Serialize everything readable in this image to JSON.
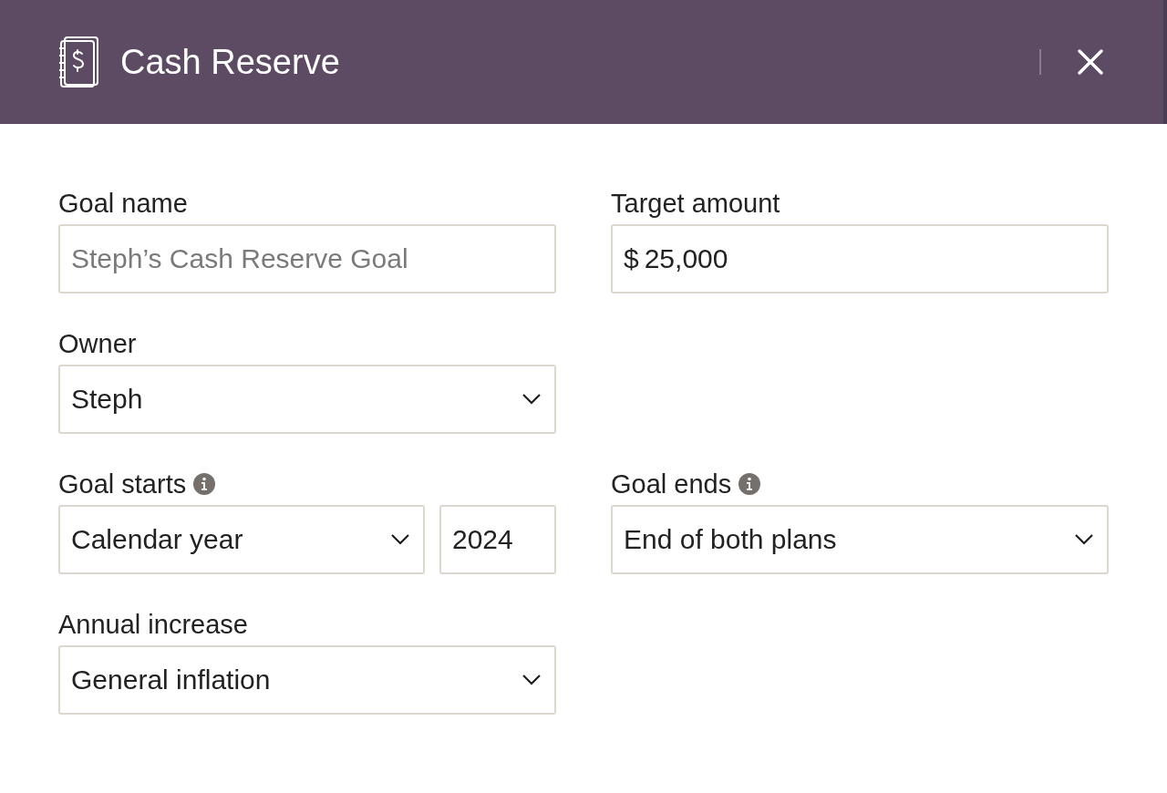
{
  "dialog": {
    "title": "Cash Reserve"
  },
  "rows": [
    {
      "fields": [
        {
          "label": "Goal name",
          "info": false,
          "controls": [
            {
              "kind": "text",
              "placeholder": "Steph’s Cash Reserve Goal"
            }
          ]
        },
        {
          "label": "Target amount",
          "info": false,
          "controls": [
            {
              "kind": "amount",
              "prefix": "$",
              "value": "25,000"
            }
          ]
        }
      ]
    },
    {
      "fields": [
        {
          "label": "Owner",
          "info": false,
          "controls": [
            {
              "kind": "select",
              "value": "Steph"
            }
          ]
        }
      ]
    },
    {
      "fields": [
        {
          "label": "Goal starts",
          "info": true,
          "controls": [
            {
              "kind": "select",
              "value": "Calendar year"
            },
            {
              "kind": "text",
              "value": "2024"
            }
          ]
        },
        {
          "label": "Goal ends",
          "info": true,
          "controls": [
            {
              "kind": "select",
              "value": "End of both plans"
            }
          ]
        }
      ]
    },
    {
      "fields": [
        {
          "label": "Annual increase",
          "info": false,
          "controls": [
            {
              "kind": "select",
              "value": "General inflation"
            }
          ]
        }
      ]
    }
  ]
}
